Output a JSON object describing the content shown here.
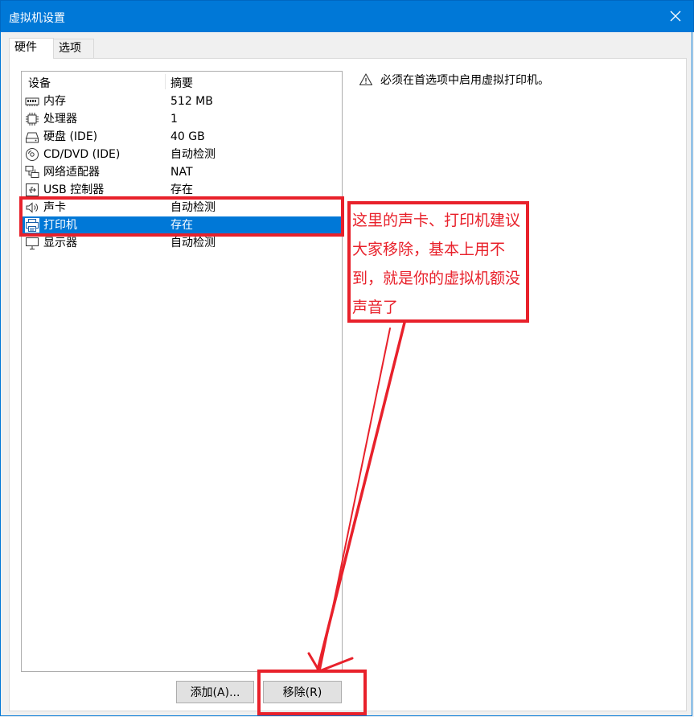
{
  "window": {
    "title": "虚拟机设置"
  },
  "tabs": [
    {
      "label": "硬件",
      "active": true
    },
    {
      "label": "选项",
      "active": false
    }
  ],
  "device_list": {
    "columns": {
      "device": "设备",
      "summary": "摘要"
    },
    "rows": [
      {
        "icon": "memory-icon",
        "name": "内存",
        "summary": "512 MB"
      },
      {
        "icon": "processor-icon",
        "name": "处理器",
        "summary": "1"
      },
      {
        "icon": "hard-disk-icon",
        "name": "硬盘 (IDE)",
        "summary": "40 GB"
      },
      {
        "icon": "cd-dvd-icon",
        "name": "CD/DVD (IDE)",
        "summary": "自动检测"
      },
      {
        "icon": "network-adapter-icon",
        "name": "网络适配器",
        "summary": "NAT"
      },
      {
        "icon": "usb-icon",
        "name": "USB 控制器",
        "summary": "存在"
      },
      {
        "icon": "speaker-icon",
        "name": "声卡",
        "summary": "自动检测"
      },
      {
        "icon": "printer-icon",
        "name": "打印机",
        "summary": "存在",
        "selected": true
      },
      {
        "icon": "display-icon",
        "name": "显示器",
        "summary": "自动检测"
      }
    ]
  },
  "notice": {
    "icon": "warning-icon",
    "text": "必须在首选项中启用虚拟打印机。"
  },
  "buttons": {
    "add": "添加(A)...",
    "remove": "移除(R)"
  },
  "annotation": {
    "text": "这里的声卡、打印机建议大家移除，基本上用不到，就是你的虚拟机额没声音了",
    "color": "#e8212b"
  },
  "colors": {
    "titlebar": "#0078d7",
    "selection": "#0078d7",
    "annotation": "#e8212b"
  }
}
